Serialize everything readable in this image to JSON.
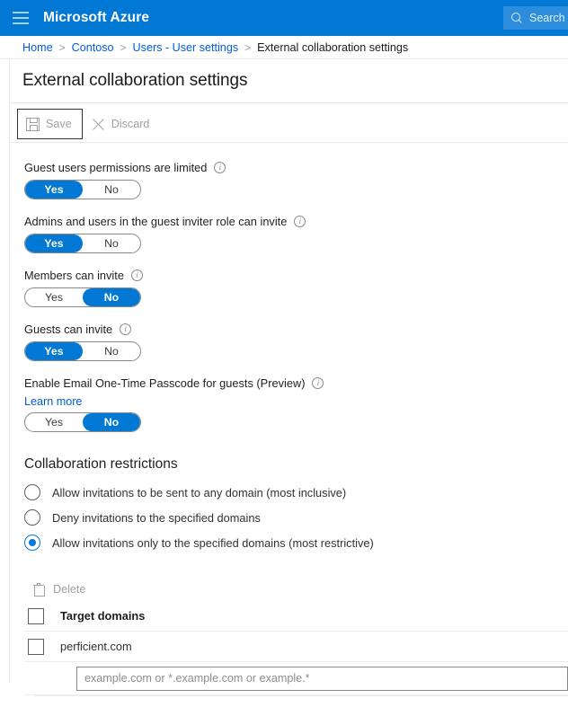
{
  "topbar": {
    "menu_icon": "hamburger-icon",
    "brand": "Microsoft Azure",
    "search_icon": "search-icon",
    "search_placeholder": "Search"
  },
  "breadcrumb": {
    "items": [
      {
        "label": "Home",
        "current": false
      },
      {
        "label": "Contoso",
        "current": false
      },
      {
        "label": "Users - User settings",
        "current": false
      },
      {
        "label": "External collaboration settings",
        "current": true
      }
    ],
    "separator": ">"
  },
  "page": {
    "title": "External collaboration settings"
  },
  "command_bar": {
    "save": {
      "label": "Save",
      "icon": "save-icon",
      "disabled": true,
      "focused": true
    },
    "discard": {
      "label": "Discard",
      "icon": "close-icon",
      "disabled": true
    }
  },
  "settings": [
    {
      "label": "Guest users permissions are limited",
      "info_icon": "info-icon",
      "options": [
        "Yes",
        "No"
      ],
      "selected": "Yes"
    },
    {
      "label": "Admins and users in the guest inviter role can invite",
      "info_icon": "info-icon",
      "options": [
        "Yes",
        "No"
      ],
      "selected": "Yes"
    },
    {
      "label": "Members can invite",
      "info_icon": "info-icon",
      "options": [
        "Yes",
        "No"
      ],
      "selected": "No"
    },
    {
      "label": "Guests can invite",
      "info_icon": "info-icon",
      "options": [
        "Yes",
        "No"
      ],
      "selected": "Yes"
    },
    {
      "label": "Enable Email One-Time Passcode for guests (Preview)",
      "info_icon": "info-icon",
      "link": "Learn more",
      "options": [
        "Yes",
        "No"
      ],
      "selected": "No"
    }
  ],
  "collaboration_restrictions": {
    "heading": "Collaboration restrictions",
    "options": [
      {
        "label": "Allow invitations to be sent to any domain (most inclusive)",
        "selected": false
      },
      {
        "label": "Deny invitations to the specified domains",
        "selected": false
      },
      {
        "label": "Allow invitations only to the specified domains (most restrictive)",
        "selected": true
      }
    ]
  },
  "domains_table": {
    "delete_button": {
      "label": "Delete",
      "icon": "trash-icon",
      "disabled": true
    },
    "column_header": "Target domains",
    "rows": [
      {
        "value": "perficient.com",
        "checked": false
      }
    ],
    "new_domain_placeholder": "example.com or *.example.com or example.*",
    "new_domain_value": ""
  },
  "colors": {
    "azure_blue": "#0078d4",
    "link_blue": "#015cda",
    "disabled_gray": "#a19f9d",
    "text": "#201f1e"
  }
}
